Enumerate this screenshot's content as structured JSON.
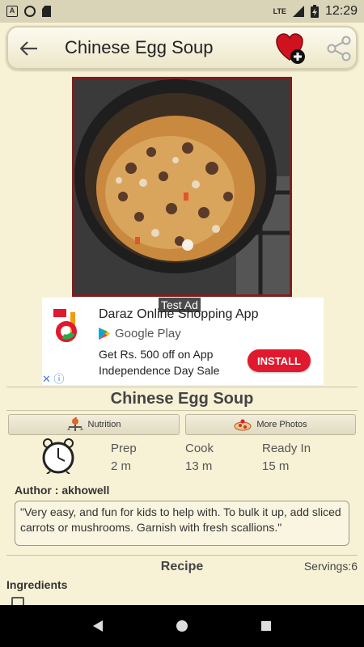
{
  "status_bar": {
    "time": "12:29",
    "network": "LTE"
  },
  "toolbar": {
    "title": "Chinese Egg Soup"
  },
  "ad": {
    "tag": "Test Ad",
    "title": "Daraz Online Shopping App",
    "store": "Google Play",
    "line1": "Get Rs. 500 off on App",
    "line2": "Independence Day Sale",
    "install_label": "INSTALL",
    "close_glyph": "✕ ⓘ"
  },
  "recipe": {
    "title": "Chinese Egg Soup",
    "nutrition_label": "Nutrition",
    "more_photos_label": "More Photos",
    "prep": {
      "label": "Prep",
      "value": "2 m"
    },
    "cook": {
      "label": "Cook",
      "value": "13 m"
    },
    "ready": {
      "label": "Ready In",
      "value": "15 m"
    },
    "author": "Author : akhowell",
    "description": "\"Very easy, and fun for kids to help with.  To bulk it up, add sliced carrots or mushrooms. Garnish with fresh scallions.\"",
    "section_label": "Recipe",
    "servings": "Servings:6",
    "ingredients_label": "Ingredients"
  },
  "colors": {
    "background": "#f7f2d6",
    "install": "#e0192e",
    "heart": "#d0121f"
  },
  "icons": [
    "back-arrow-icon",
    "favorite-add-icon",
    "share-icon",
    "nutrition-icon",
    "more-photos-icon",
    "clock-icon"
  ]
}
